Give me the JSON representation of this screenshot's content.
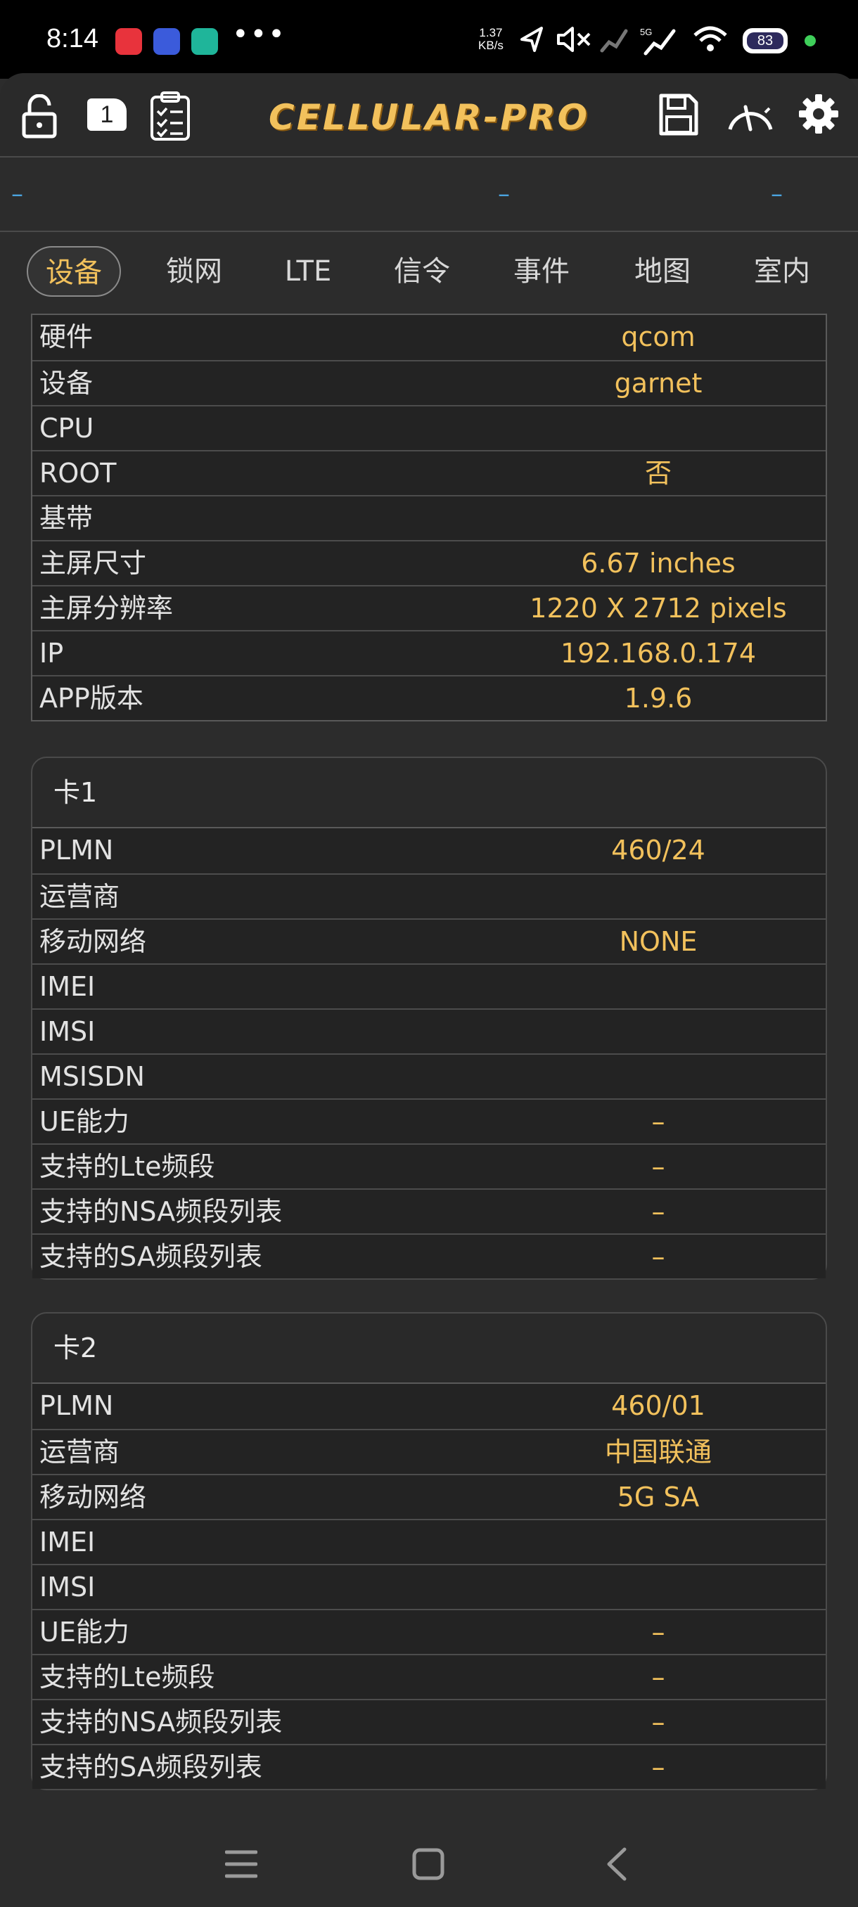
{
  "status_bar": {
    "time": "8:14",
    "net_speed_value": "1.37",
    "net_speed_unit": "KB/s",
    "battery": "83",
    "apps": [
      {
        "name": "xiaohongshu-app-icon",
        "color": "#e8333c"
      },
      {
        "name": "blue-app-icon",
        "color": "#3b5bdb"
      },
      {
        "name": "teal-app-icon",
        "color": "#1fb59a"
      }
    ]
  },
  "app_bar": {
    "title": "CELLULAR-PRO",
    "document_count": "1",
    "accent_color": "#f2c15c"
  },
  "info_strip": {
    "left": "–",
    "center": "–",
    "right": "–"
  },
  "tabs": [
    {
      "label": "设备",
      "active": true
    },
    {
      "label": "锁网",
      "active": false
    },
    {
      "label": "LTE",
      "active": false
    },
    {
      "label": "信令",
      "active": false
    },
    {
      "label": "事件",
      "active": false
    },
    {
      "label": "地图",
      "active": false
    },
    {
      "label": "室内",
      "active": false
    }
  ],
  "device_table": [
    {
      "key": "硬件",
      "value": "qcom"
    },
    {
      "key": "设备",
      "value": "garnet"
    },
    {
      "key": "CPU",
      "value": ""
    },
    {
      "key": "ROOT",
      "value": "否"
    },
    {
      "key": "基带",
      "value": ""
    },
    {
      "key": "主屏尺寸",
      "value": "6.67 inches"
    },
    {
      "key": "主屏分辨率",
      "value": "1220 X 2712 pixels"
    },
    {
      "key": "IP",
      "value": "192.168.0.174"
    },
    {
      "key": "APP版本",
      "value": "1.9.6"
    }
  ],
  "sim1": {
    "title": "卡1",
    "rows": [
      {
        "key": "PLMN",
        "value": "460/24"
      },
      {
        "key": "运营商",
        "value": ""
      },
      {
        "key": "移动网络",
        "value": "NONE"
      },
      {
        "key": "IMEI",
        "value": ""
      },
      {
        "key": "IMSI",
        "value": ""
      },
      {
        "key": "MSISDN",
        "value": ""
      },
      {
        "key": "UE能力",
        "value": "–"
      },
      {
        "key": "支持的Lte频段",
        "value": "–"
      },
      {
        "key": "支持的NSA频段列表",
        "value": "–"
      },
      {
        "key": "支持的SA频段列表",
        "value": "–"
      }
    ]
  },
  "sim2": {
    "title": "卡2",
    "rows": [
      {
        "key": "PLMN",
        "value": "460/01"
      },
      {
        "key": "运营商",
        "value": "中国联通"
      },
      {
        "key": "移动网络",
        "value": "5G SA"
      },
      {
        "key": "IMEI",
        "value": ""
      },
      {
        "key": "IMSI",
        "value": ""
      },
      {
        "key": "UE能力",
        "value": "–"
      },
      {
        "key": "支持的Lte频段",
        "value": "–"
      },
      {
        "key": "支持的NSA频段列表",
        "value": "–"
      },
      {
        "key": "支持的SA频段列表",
        "value": "–"
      }
    ]
  }
}
